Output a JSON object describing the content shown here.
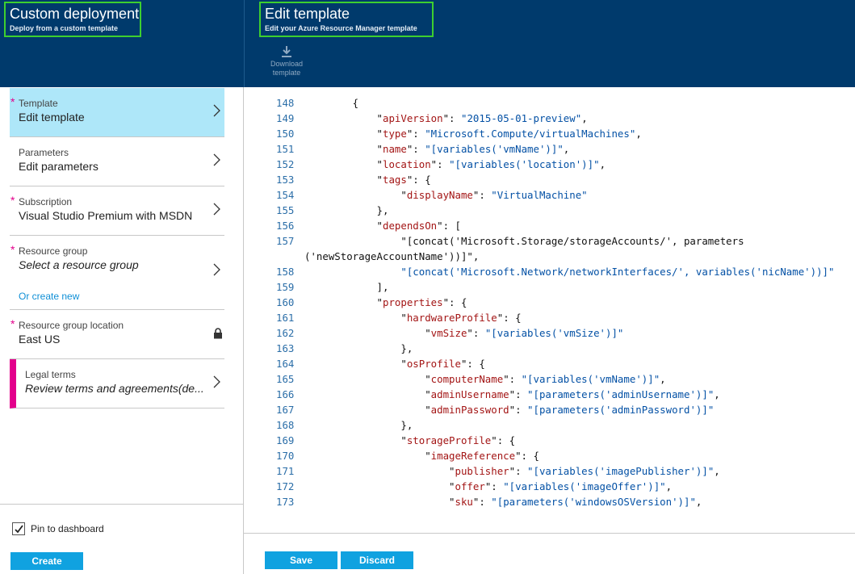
{
  "left_blade": {
    "title": "Custom deployment",
    "subtitle": "Deploy from a custom template",
    "steps": [
      {
        "label": "Template",
        "value": "Edit template",
        "required": true
      },
      {
        "label": "Parameters",
        "value": "Edit parameters",
        "required": false
      },
      {
        "label": "Subscription",
        "value": "Visual Studio Premium with MSDN",
        "required": true
      },
      {
        "label": "Resource group",
        "value": "Select a resource group",
        "required": true,
        "link": "Or create new"
      },
      {
        "label": "Resource group location",
        "value": "East US",
        "required": true
      },
      {
        "label": "Legal terms",
        "value": "Review terms and agreements(de...",
        "required": false
      }
    ],
    "required_marker": "*",
    "pin_label": "Pin to dashboard",
    "pin_checked": true,
    "create_label": "Create"
  },
  "right_blade": {
    "title": "Edit template",
    "subtitle": "Edit your Azure Resource Manager template",
    "download_label_1": "Download",
    "download_label_2": "template",
    "save_label": "Save",
    "discard_label": "Discard"
  },
  "code_lines": [
    {
      "n": "148",
      "t": "        {"
    },
    {
      "n": "149",
      "t": "            \"apiVersion\": \"2015-05-01-preview\","
    },
    {
      "n": "150",
      "t": "            \"type\": \"Microsoft.Compute/virtualMachines\","
    },
    {
      "n": "151",
      "t": "            \"name\": \"[variables('vmName')]\","
    },
    {
      "n": "152",
      "t": "            \"location\": \"[variables('location')]\","
    },
    {
      "n": "153",
      "t": "            \"tags\": {"
    },
    {
      "n": "154",
      "t": "                \"displayName\": \"VirtualMachine\""
    },
    {
      "n": "155",
      "t": "            },"
    },
    {
      "n": "156",
      "t": "            \"dependsOn\": ["
    },
    {
      "n": "157",
      "t": "                \"[concat('Microsoft.Storage/storageAccounts/', parameters"
    },
    {
      "n": "",
      "t": "('newStorageAccountName'))]\","
    },
    {
      "n": "158",
      "t": "                \"[concat('Microsoft.Network/networkInterfaces/', variables('nicName'))]\""
    },
    {
      "n": "159",
      "t": "            ],"
    },
    {
      "n": "160",
      "t": "            \"properties\": {"
    },
    {
      "n": "161",
      "t": "                \"hardwareProfile\": {"
    },
    {
      "n": "162",
      "t": "                    \"vmSize\": \"[variables('vmSize')]\""
    },
    {
      "n": "163",
      "t": "                },"
    },
    {
      "n": "164",
      "t": "                \"osProfile\": {"
    },
    {
      "n": "165",
      "t": "                    \"computerName\": \"[variables('vmName')]\","
    },
    {
      "n": "166",
      "t": "                    \"adminUsername\": \"[parameters('adminUsername')]\","
    },
    {
      "n": "167",
      "t": "                    \"adminPassword\": \"[parameters('adminPassword')]\""
    },
    {
      "n": "168",
      "t": "                },"
    },
    {
      "n": "169",
      "t": "                \"storageProfile\": {"
    },
    {
      "n": "170",
      "t": "                    \"imageReference\": {"
    },
    {
      "n": "171",
      "t": "                        \"publisher\": \"[variables('imagePublisher')]\","
    },
    {
      "n": "172",
      "t": "                        \"offer\": \"[variables('imageOffer')]\","
    },
    {
      "n": "173",
      "t": "                        \"sku\": \"[parameters('windowsOSVersion')]\","
    }
  ],
  "colors": {
    "header_bg": "#003a6c",
    "highlight_border": "#3ecf2f",
    "active_step": "#aee7f9",
    "required": "#e3008c",
    "button": "#10a2e0",
    "link": "#0f8fd6",
    "json_key": "#a31515",
    "json_string": "#0451a5"
  },
  "icons": [
    "chevron-right-icon",
    "lock-icon",
    "download-icon",
    "checkmark-icon"
  ]
}
